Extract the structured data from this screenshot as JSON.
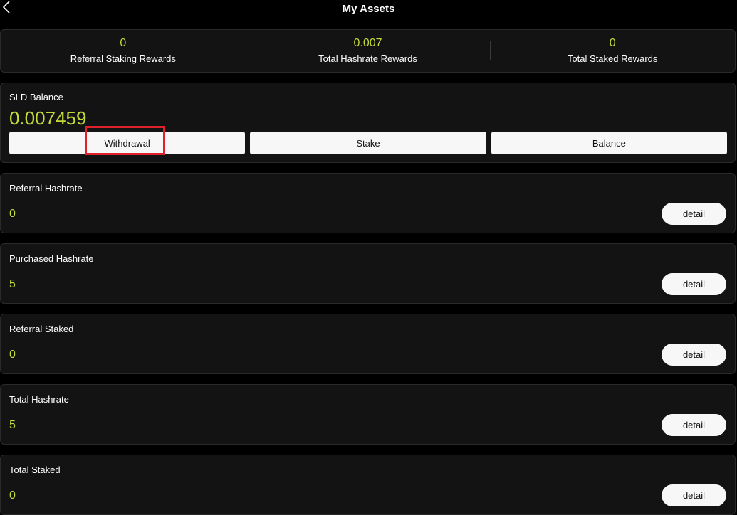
{
  "header": {
    "title": "My Assets",
    "back_icon": "chevron-left-icon"
  },
  "summary": [
    {
      "value": "0",
      "label": "Referral Staking Rewards"
    },
    {
      "value": "0.007",
      "label": "Total Hashrate Rewards"
    },
    {
      "value": "0",
      "label": "Total Staked Rewards"
    }
  ],
  "balance": {
    "label": "SLD Balance",
    "value": "0.007459",
    "actions": [
      "Withdrawal",
      "Stake",
      "Balance"
    ]
  },
  "metrics": [
    {
      "label": "Referral Hashrate",
      "value": "0",
      "button": "detail"
    },
    {
      "label": "Purchased Hashrate",
      "value": "5",
      "button": "detail"
    },
    {
      "label": "Referral Staked",
      "value": "0",
      "button": "detail"
    },
    {
      "label": "Total Hashrate",
      "value": "5",
      "button": "detail"
    },
    {
      "label": "Total Staked",
      "value": "0",
      "button": "detail"
    }
  ],
  "colors": {
    "accent": "#c4d93a",
    "background": "#000000",
    "card": "#131313",
    "highlight": "#e0202a"
  }
}
